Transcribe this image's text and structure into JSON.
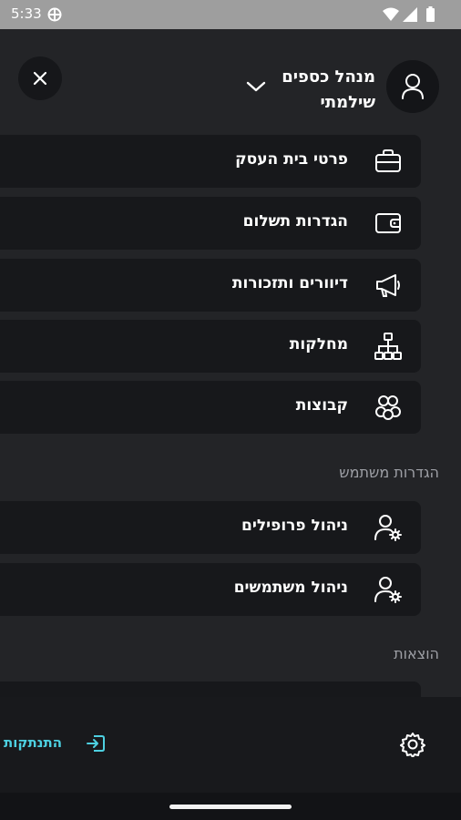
{
  "status": {
    "time": "5:33"
  },
  "header": {
    "org_name_line1": "מנהל כספים",
    "org_name_line2": "שילמתי"
  },
  "menu": [
    {
      "label": "פרטי בית העסק",
      "icon": "briefcase-icon"
    },
    {
      "label": "הגדרות תשלום",
      "icon": "wallet-icon"
    },
    {
      "label": "דיוורים ותזכורות",
      "icon": "megaphone-icon"
    },
    {
      "label": "מחלקות",
      "icon": "hierarchy-icon"
    },
    {
      "label": "קבוצות",
      "icon": "group-icon"
    }
  ],
  "user_settings": {
    "title": "הגדרות משתמש",
    "items": [
      {
        "label": "ניהול פרופילים",
        "icon": "user-gear-icon"
      },
      {
        "label": "ניהול משתמשים",
        "icon": "user-gear-icon"
      }
    ]
  },
  "expenses": {
    "title": "הוצאות"
  },
  "footer": {
    "logout_label": "התנתקות",
    "accent": "#4dd0e1"
  }
}
